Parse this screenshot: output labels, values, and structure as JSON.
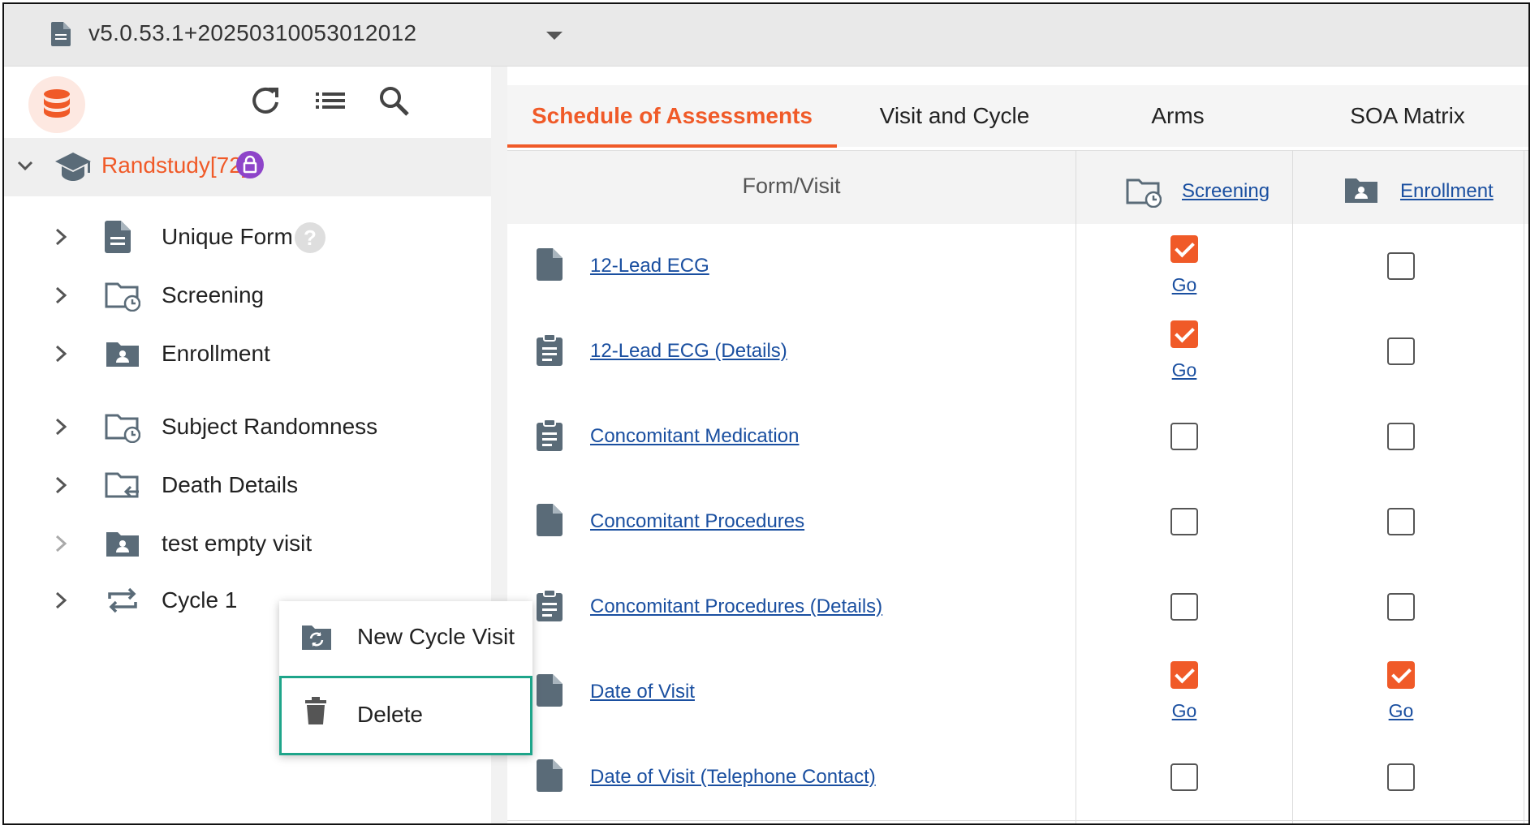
{
  "topbar": {
    "version": "v5.0.53.1+20250310053012012"
  },
  "study": {
    "name": "Randstudy[72]"
  },
  "tree": {
    "items": [
      {
        "label": "Unique Form",
        "icon": "document-icon",
        "badge": "?"
      },
      {
        "label": "Screening",
        "icon": "folder-clock-icon"
      },
      {
        "label": "Enrollment",
        "icon": "folder-person-icon"
      },
      {
        "label": "Subject Randomness",
        "icon": "folder-clock-icon"
      },
      {
        "label": "Death Details",
        "icon": "folder-arrow-icon"
      },
      {
        "label": "test empty visit",
        "icon": "folder-person-icon"
      },
      {
        "label": "Cycle 1",
        "icon": "cycle-icon"
      }
    ]
  },
  "tabs": [
    {
      "label": "Schedule of Assessments",
      "active": true
    },
    {
      "label": "Visit and Cycle"
    },
    {
      "label": "Arms"
    },
    {
      "label": "SOA Matrix"
    }
  ],
  "table": {
    "header_form": "Form/Visit",
    "columns": [
      {
        "label": "Screening",
        "icon": "folder-clock-icon"
      },
      {
        "label": "Enrollment",
        "icon": "folder-person-icon"
      }
    ],
    "go_label": "Go",
    "rows": [
      {
        "form": "12-Lead ECG",
        "icon": "document-icon",
        "checks": [
          true,
          false
        ]
      },
      {
        "form": "12-Lead ECG (Details)",
        "icon": "clipboard-icon",
        "checks": [
          true,
          false
        ]
      },
      {
        "form": "Concomitant Medication",
        "icon": "clipboard-icon",
        "checks": [
          false,
          false
        ]
      },
      {
        "form": "Concomitant Procedures",
        "icon": "document-icon",
        "checks": [
          false,
          false
        ]
      },
      {
        "form": "Concomitant Procedures (Details)",
        "icon": "clipboard-icon",
        "checks": [
          false,
          false
        ]
      },
      {
        "form": "Date of Visit",
        "icon": "document-icon",
        "checks": [
          true,
          true
        ]
      },
      {
        "form": "Date of Visit (Telephone Contact)",
        "icon": "document-icon",
        "checks": [
          false,
          false
        ]
      }
    ]
  },
  "context_menu": {
    "items": [
      {
        "label": "New Cycle Visit",
        "icon": "cycle-folder-icon"
      },
      {
        "label": "Delete",
        "icon": "trash-icon"
      }
    ]
  },
  "colors": {
    "accent": "#f05a28",
    "link": "#1a4fa0",
    "lock": "#8e44c9",
    "icon": "#5a6b78",
    "highlight": "#1ea58a"
  }
}
